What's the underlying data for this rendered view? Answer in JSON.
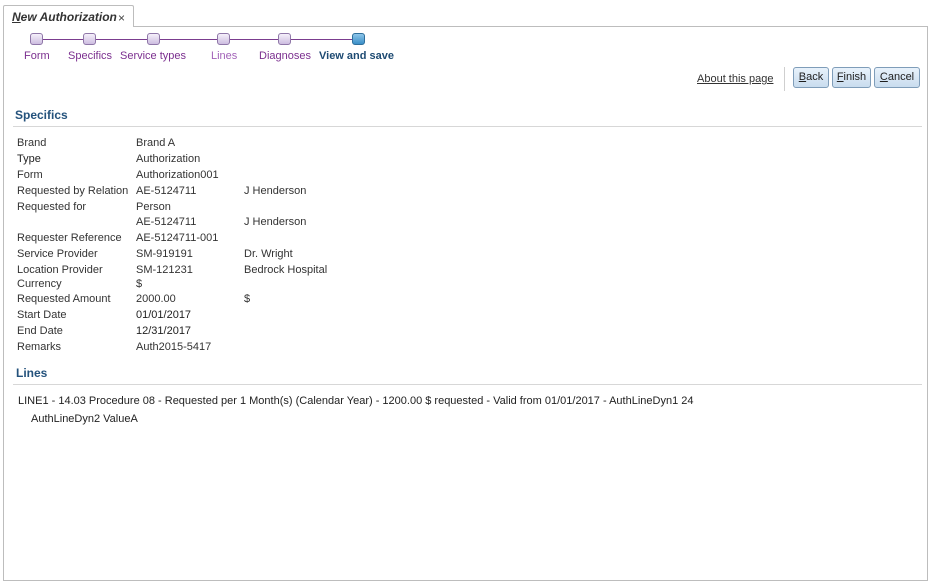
{
  "tab": {
    "title_first_letter": "N",
    "title_rest": "ew Authorization",
    "close_glyph": "×"
  },
  "train": {
    "steps": [
      {
        "label": "Form"
      },
      {
        "label": "Specifics"
      },
      {
        "label": "Service types"
      },
      {
        "label": "Lines"
      },
      {
        "label": "Diagnoses"
      },
      {
        "label": "View and save"
      }
    ]
  },
  "actions": {
    "about": "About this page",
    "back": {
      "first": "B",
      "rest": "ack"
    },
    "finish": {
      "first": "F",
      "rest": "inish"
    },
    "cancel": {
      "first": "C",
      "rest": "ancel"
    }
  },
  "specifics": {
    "title": "Specifics",
    "rows": [
      {
        "label": "Brand",
        "value": "Brand A",
        "extra": ""
      },
      {
        "label": "Type",
        "value": "Authorization",
        "extra": ""
      },
      {
        "label": "Form",
        "value": "Authorization001",
        "extra": ""
      },
      {
        "label": "Requested by Relation",
        "value": "AE-5124711",
        "extra": "J Henderson"
      },
      {
        "label": "Requested for",
        "value": "Person",
        "extra": ""
      },
      {
        "label": "",
        "value": "AE-5124711",
        "extra": "J Henderson"
      },
      {
        "label": "Requester Reference",
        "value": "AE-5124711-001",
        "extra": ""
      },
      {
        "label": "Service Provider",
        "value": "SM-919191",
        "extra": "Dr. Wright"
      },
      {
        "label": "Location Provider",
        "value": "SM-121231",
        "extra": "Bedrock Hospital"
      },
      {
        "label": "Currency",
        "value": "$",
        "extra": ""
      },
      {
        "label": "Requested Amount",
        "value": "2000.00",
        "extra": "$"
      },
      {
        "label": "Start Date",
        "value": "01/01/2017",
        "extra": ""
      },
      {
        "label": "End Date",
        "value": "12/31/2017",
        "extra": ""
      },
      {
        "label": "Remarks",
        "value": "Auth2015-5417",
        "extra": ""
      }
    ]
  },
  "lines": {
    "title": "Lines",
    "line1": "LINE1 - 14.03 Procedure 08 - Requested per 1 Month(s) (Calendar Year) - 1200.00 $ requested - Valid from 01/01/2017 - AuthLineDyn1 24",
    "line1_detail": "AuthLineDyn2 ValueA"
  },
  "colors": {
    "train_link": "#7b2f8f",
    "train_current": "#1d4a72",
    "section_title": "#24527c",
    "button_border": "#7f9db9"
  }
}
